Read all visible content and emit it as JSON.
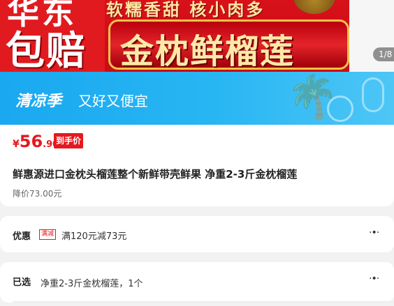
{
  "banner": {
    "top_text": "华东",
    "left_big": "包赔",
    "sub_text": "软糯香甜 核小肉多",
    "main_text": "金枕鲜榴莲",
    "page_indicator": "1/8"
  },
  "promo": {
    "title": "清凉季",
    "slogan": "又好又便宜"
  },
  "product": {
    "currency": "¥",
    "price_int": "56",
    "price_dec": ".90",
    "price_badge": "到手价",
    "title": "鲜惠源进口金枕头榴莲整个新鲜带壳鲜果 净重2-3斤金枕榴莲",
    "original_price": "降价73.00元"
  },
  "benefit": {
    "label": "优惠",
    "tag": "满减",
    "text": "满120元减73元",
    "more_icon": "more-dots-icon"
  },
  "selected": {
    "label": "已选",
    "text": "净重2-3斤金枕榴莲，1个",
    "more_icon": "more-dots-icon"
  },
  "colors": {
    "accent_red": "#e4191f",
    "promo_blue": "#1aa8f0"
  }
}
